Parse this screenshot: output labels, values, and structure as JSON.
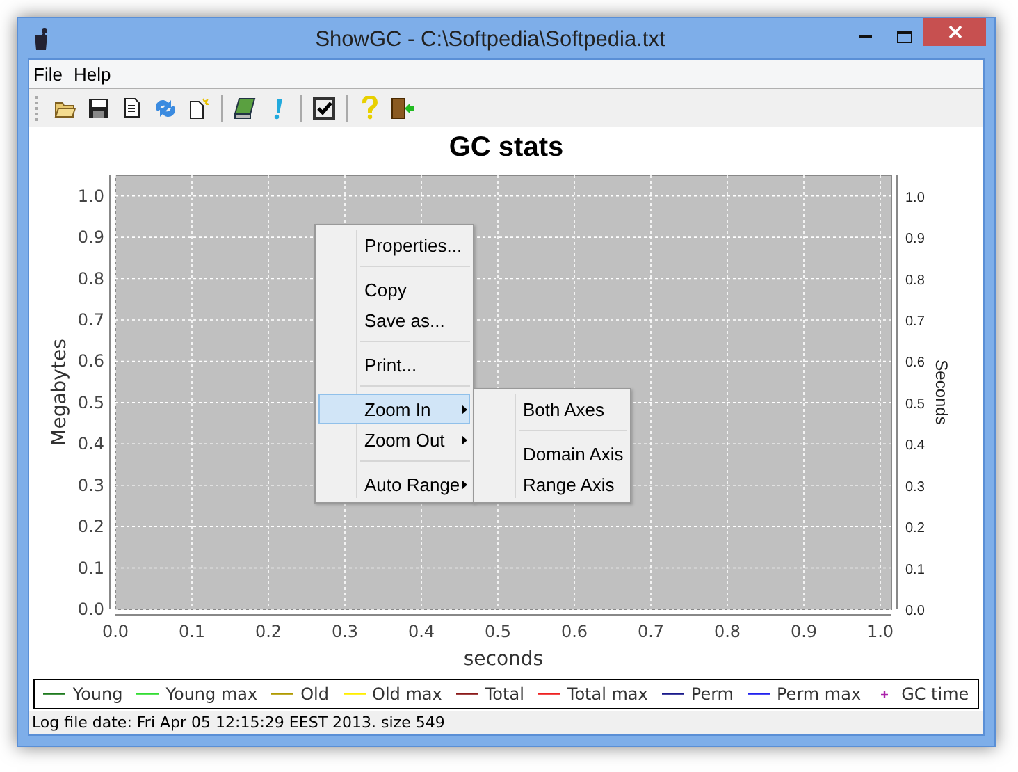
{
  "window": {
    "title": "ShowGC - C:\\Softpedia\\Softpedia.txt"
  },
  "menu_bar": [
    "File",
    "Help"
  ],
  "chart": {
    "chart_data": {
      "type": "line",
      "title": "GC stats",
      "xlabel": "seconds",
      "ylabel": "Megabytes",
      "ylim": [
        0,
        1.05
      ],
      "grid": true,
      "categories": [
        "0.0",
        "0.1",
        "0.2",
        "0.3",
        "0.4",
        "0.5",
        "0.6",
        "0.7",
        "0.8",
        "0.9",
        "1.0"
      ],
      "yticks": [
        {
          "value": 0,
          "label": "0.0"
        },
        {
          "value": 0.1,
          "label": "0.1"
        },
        {
          "value": 0.2,
          "label": "0.2"
        },
        {
          "value": 0.3,
          "label": "0.3"
        },
        {
          "value": 0.4,
          "label": "0.4"
        },
        {
          "value": 0.5,
          "label": "0.5"
        },
        {
          "value": 0.6,
          "label": "0.6"
        },
        {
          "value": 0.7,
          "label": "0.7"
        },
        {
          "value": 0.8,
          "label": "0.8"
        },
        {
          "value": 0.9,
          "label": "0.9"
        },
        {
          "value": 1,
          "label": "1.0"
        }
      ],
      "series": [
        {
          "name": "Young",
          "color": "#1f7a1f",
          "values": [
            null,
            null,
            null,
            null,
            null,
            null,
            null,
            null,
            null,
            null,
            null
          ]
        },
        {
          "name": "Young max",
          "color": "#33dd33",
          "values": [
            null,
            null,
            null,
            null,
            null,
            null,
            null,
            null,
            null,
            null,
            null
          ]
        },
        {
          "name": "Old",
          "color": "#b09a00",
          "values": [
            null,
            null,
            null,
            null,
            null,
            null,
            null,
            null,
            null,
            null,
            null
          ]
        },
        {
          "name": "Old max",
          "color": "#ffee00",
          "values": [
            null,
            null,
            null,
            null,
            null,
            null,
            null,
            null,
            null,
            null,
            null
          ]
        },
        {
          "name": "Total",
          "color": "#8b1a1a",
          "values": [
            null,
            null,
            null,
            null,
            null,
            null,
            null,
            null,
            null,
            null,
            null
          ]
        },
        {
          "name": "Total max",
          "color": "#ee2222",
          "values": [
            null,
            null,
            null,
            null,
            null,
            null,
            null,
            null,
            null,
            null,
            null
          ]
        },
        {
          "name": "Perm",
          "color": "#1a1a8b",
          "values": [
            null,
            null,
            null,
            null,
            null,
            null,
            null,
            null,
            null,
            null,
            null
          ]
        },
        {
          "name": "Perm max",
          "color": "#2222ee",
          "values": [
            null,
            null,
            null,
            null,
            null,
            null,
            null,
            null,
            null,
            null,
            null
          ]
        },
        {
          "name": "GC time",
          "color": "#aa22aa",
          "values": [
            null,
            null,
            null,
            null,
            null,
            null,
            null,
            null,
            null,
            null,
            null
          ]
        }
      ]
    },
    "legend": [
      {
        "kind": "series"
      },
      {
        "kind": "series"
      },
      {
        "kind": "series"
      },
      {
        "kind": "series"
      },
      {
        "kind": "series"
      },
      {
        "kind": "series"
      },
      {
        "kind": "series"
      },
      {
        "kind": "series"
      },
      {
        "kind": "plus"
      }
    ],
    "right_axis": {
      "label": "Seconds",
      "ticks": [
        "1.0",
        "0.9",
        "0.8",
        "0.7",
        "0.6",
        "0.5",
        "0.4",
        "0.3",
        "0.2",
        "0.1",
        "0.0"
      ]
    }
  },
  "context_menu": {
    "items": [
      {
        "kind": "item",
        "label": "Properties...",
        "has_submenu": false,
        "selected": false
      },
      {
        "kind": "separator"
      },
      {
        "kind": "item",
        "label": "Copy",
        "has_submenu": false,
        "selected": false
      },
      {
        "kind": "item",
        "label": "Save as...",
        "has_submenu": false,
        "selected": false
      },
      {
        "kind": "separator"
      },
      {
        "kind": "item",
        "label": "Print...",
        "has_submenu": false,
        "selected": false
      },
      {
        "kind": "separator"
      },
      {
        "kind": "item",
        "label": "Zoom In",
        "has_submenu": true,
        "selected": true
      },
      {
        "kind": "item",
        "label": "Zoom Out",
        "has_submenu": true,
        "selected": false
      },
      {
        "kind": "separator"
      },
      {
        "kind": "item",
        "label": "Auto Range",
        "has_submenu": true,
        "selected": false
      }
    ],
    "submenu": [
      {
        "kind": "item",
        "label": "Both Axes",
        "selected": false
      },
      {
        "kind": "separator"
      },
      {
        "kind": "item",
        "label": "Domain Axis",
        "selected": false
      },
      {
        "kind": "item",
        "label": "Range Axis",
        "selected": false
      }
    ]
  },
  "status_bar": "Log file date: Fri Apr 05 12:15:29 EEST 2013. size 549"
}
